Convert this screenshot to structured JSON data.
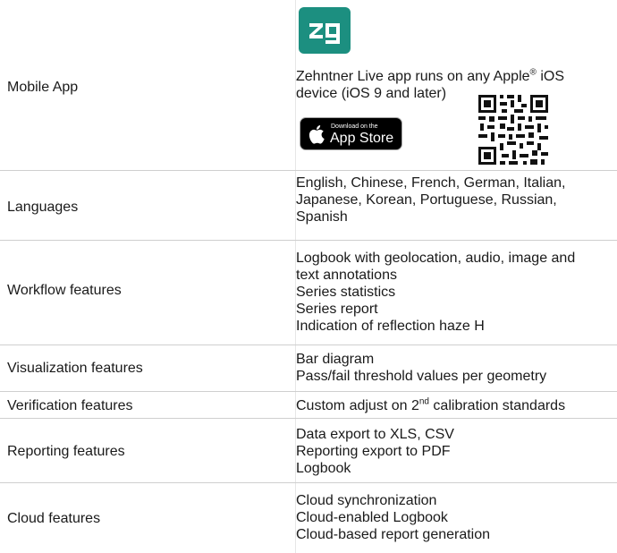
{
  "rows": [
    {
      "label": "Mobile App",
      "lines": [
        "Zehntner Live app runs on any Apple",
        "device  (iOS 9 and later)"
      ],
      "registered": "®",
      "line1_tail": " iOS",
      "appstore_small": "Download on the",
      "appstore_big": "App Store"
    },
    {
      "label": "Languages",
      "lines": [
        "English, Chinese, French, German, Italian,",
        "Japanese, Korean, Portuguese, Russian,",
        "Spanish"
      ]
    },
    {
      "label": "Workflow features",
      "lines": [
        "Logbook with geolocation, audio, image and",
        "text annotations",
        "Series statistics",
        "Series report",
        "Indication of reflection haze H"
      ]
    },
    {
      "label": "Visualization features",
      "lines": [
        "Bar diagram",
        "Pass/fail threshold values per geometry"
      ]
    },
    {
      "label": "Verification features",
      "pre": "Custom adjust on 2",
      "sup": "nd",
      "post": " calibration standards"
    },
    {
      "label": "Reporting features",
      "lines": [
        "Data export to XLS, CSV",
        "Reporting export to PDF",
        "Logbook"
      ]
    },
    {
      "label": "Cloud features",
      "lines": [
        "Cloud synchronization",
        "Cloud-enabled Logbook",
        "Cloud-based report generation"
      ]
    }
  ],
  "colors": {
    "logo": "#1c8f80",
    "rule": "#cfcfcf"
  }
}
